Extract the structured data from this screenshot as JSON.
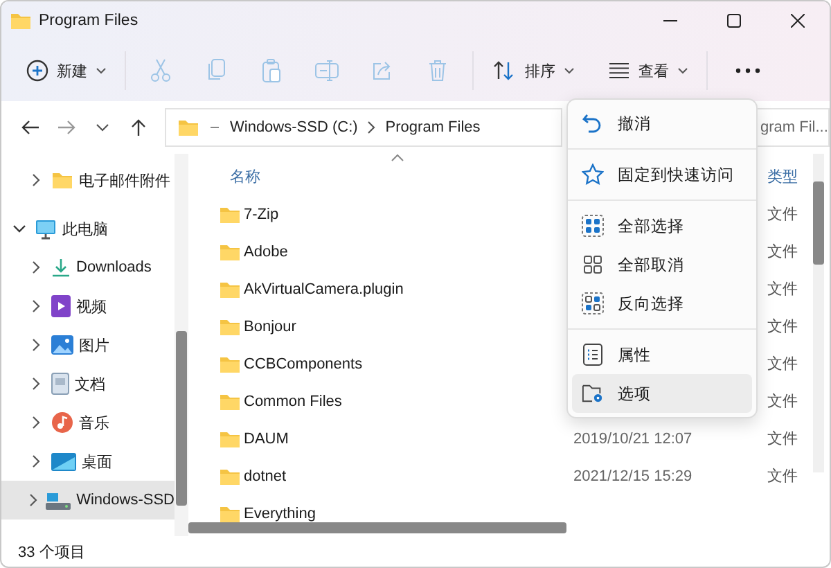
{
  "window": {
    "title": "Program Files"
  },
  "toolbar": {
    "new_button": {
      "label": "新建"
    },
    "tools": [
      {
        "kind": "cut",
        "disabled": true
      },
      {
        "kind": "copy",
        "disabled": true
      },
      {
        "kind": "paste",
        "disabled": true
      },
      {
        "kind": "rename",
        "disabled": true
      },
      {
        "kind": "share",
        "disabled": true
      },
      {
        "kind": "delete",
        "disabled": true
      }
    ],
    "sort_button": {
      "label": "排序"
    },
    "view_button": {
      "label": "查看"
    }
  },
  "navigation": {
    "back_disabled": false,
    "forward_disabled": true
  },
  "address_bar": {
    "segments": [
      "Windows-SSD (C:)",
      "Program Files"
    ]
  },
  "search": {
    "placeholder": "gram Fil..."
  },
  "sidebar": {
    "items": [
      {
        "label": "电子邮件附件",
        "kind": "folder",
        "expanded": false,
        "selected": false
      },
      {
        "label": "此电脑",
        "kind": "computer",
        "expanded": true,
        "selected": false,
        "children": [
          {
            "label": "Downloads",
            "kind": "download",
            "expanded": false,
            "selected": false
          },
          {
            "label": "视频",
            "kind": "video",
            "expanded": false,
            "selected": false
          },
          {
            "label": "图片",
            "kind": "picture",
            "expanded": false,
            "selected": false
          },
          {
            "label": "文档",
            "kind": "document",
            "expanded": false,
            "selected": false
          },
          {
            "label": "音乐",
            "kind": "music",
            "expanded": false,
            "selected": false
          },
          {
            "label": "桌面",
            "kind": "desktop",
            "expanded": false,
            "selected": false
          },
          {
            "label": "Windows-SSD",
            "kind": "drive",
            "expanded": false,
            "selected": true
          }
        ]
      }
    ]
  },
  "table": {
    "columns": [
      "名称",
      "类型"
    ],
    "rows": [
      {
        "name": "7-Zip",
        "type": "文件"
      },
      {
        "name": "Adobe",
        "type": "文件"
      },
      {
        "name": "AkVirtualCamera.plugin",
        "type": "文件"
      },
      {
        "name": "Bonjour",
        "type": "文件"
      },
      {
        "name": "CCBComponents",
        "type": "文件"
      },
      {
        "name": "Common Files",
        "type": "文件"
      },
      {
        "name": "DAUM",
        "date": "2019/10/21 12:07",
        "type": "文件"
      },
      {
        "name": "dotnet",
        "date": "2021/12/15 15:29",
        "type": "文件"
      },
      {
        "name": "Everything"
      }
    ]
  },
  "status_bar": {
    "count": "33 个项目"
  },
  "context_menu": {
    "items": [
      {
        "kind": "undo",
        "label": "撤消",
        "selected": false
      },
      {
        "kind": "separator"
      },
      {
        "kind": "pin",
        "label": "固定到快速访问",
        "selected": false
      },
      {
        "kind": "separator"
      },
      {
        "kind": "select-all",
        "label": "全部选择",
        "selected": false
      },
      {
        "kind": "select-none",
        "label": "全部取消",
        "selected": false
      },
      {
        "kind": "invert",
        "label": "反向选择",
        "selected": false
      },
      {
        "kind": "separator"
      },
      {
        "kind": "properties",
        "label": "属性",
        "selected": false
      },
      {
        "kind": "options",
        "label": "选项",
        "selected": true
      }
    ]
  }
}
